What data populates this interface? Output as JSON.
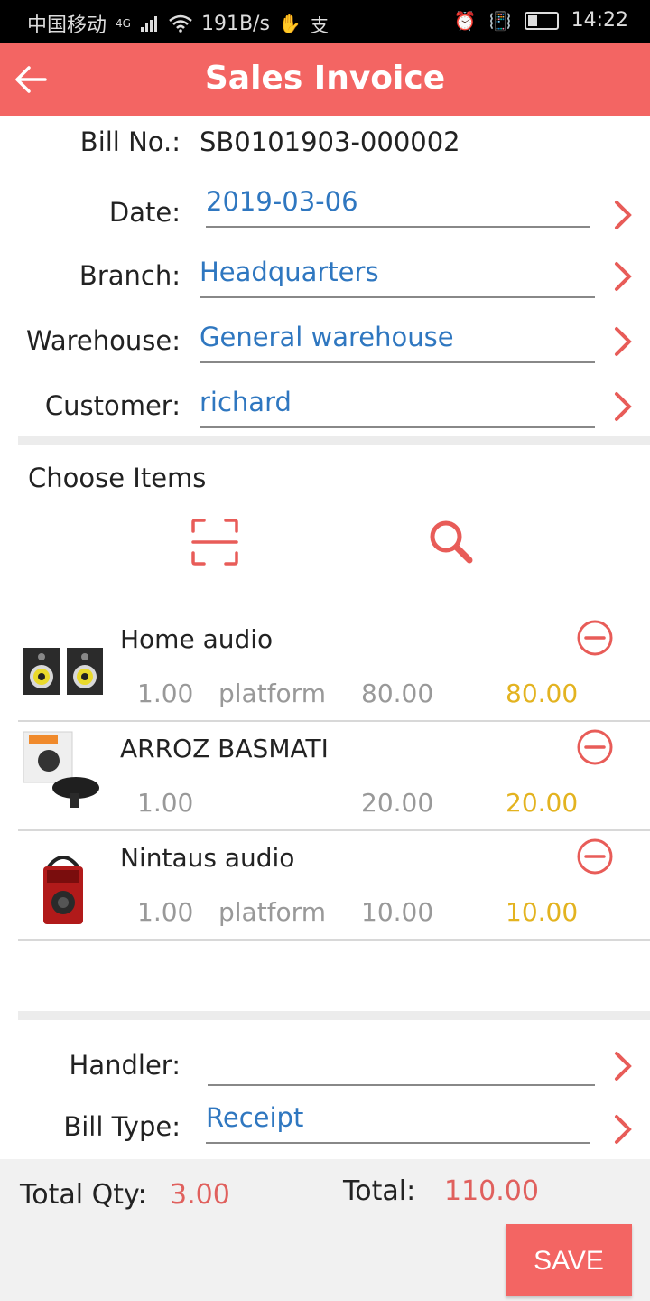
{
  "status_bar": {
    "carrier": "中国移动",
    "network": "4G",
    "speed": "191B/s",
    "extra_icons": [
      "hand-icon",
      "alipay-icon"
    ],
    "time": "14:22"
  },
  "appbar": {
    "title": "Sales Invoice"
  },
  "form": {
    "bill_no_label": "Bill No.:",
    "bill_no_value": "SB0101903-000002",
    "date_label": "Date:",
    "date_value": "2019-03-06",
    "branch_label": "Branch:",
    "branch_value": "Headquarters",
    "warehouse_label": "Warehouse:",
    "warehouse_value": "General warehouse",
    "customer_label": "Customer:",
    "customer_value": "richard"
  },
  "items_section": {
    "title": "Choose Items",
    "items": [
      {
        "name": "Home audio",
        "qty": "1.00",
        "unit": "platform",
        "price": "80.00",
        "amount": "80.00"
      },
      {
        "name": "ARROZ BASMATI",
        "qty": "1.00",
        "unit": "",
        "price": "20.00",
        "amount": "20.00"
      },
      {
        "name": "Nintaus audio",
        "qty": "1.00",
        "unit": "platform",
        "price": "10.00",
        "amount": "10.00"
      }
    ]
  },
  "extra": {
    "handler_label": "Handler:",
    "handler_value": "",
    "bill_type_label": "Bill Type:",
    "bill_type_value": "Receipt"
  },
  "footer": {
    "total_qty_label": "Total Qty:",
    "total_qty_value": "3.00",
    "total_label": "Total:",
    "total_value": "110.00",
    "save_label": "SAVE"
  },
  "colors": {
    "accent": "#f36563",
    "link": "#2f77c0",
    "amount": "#e3b320"
  }
}
